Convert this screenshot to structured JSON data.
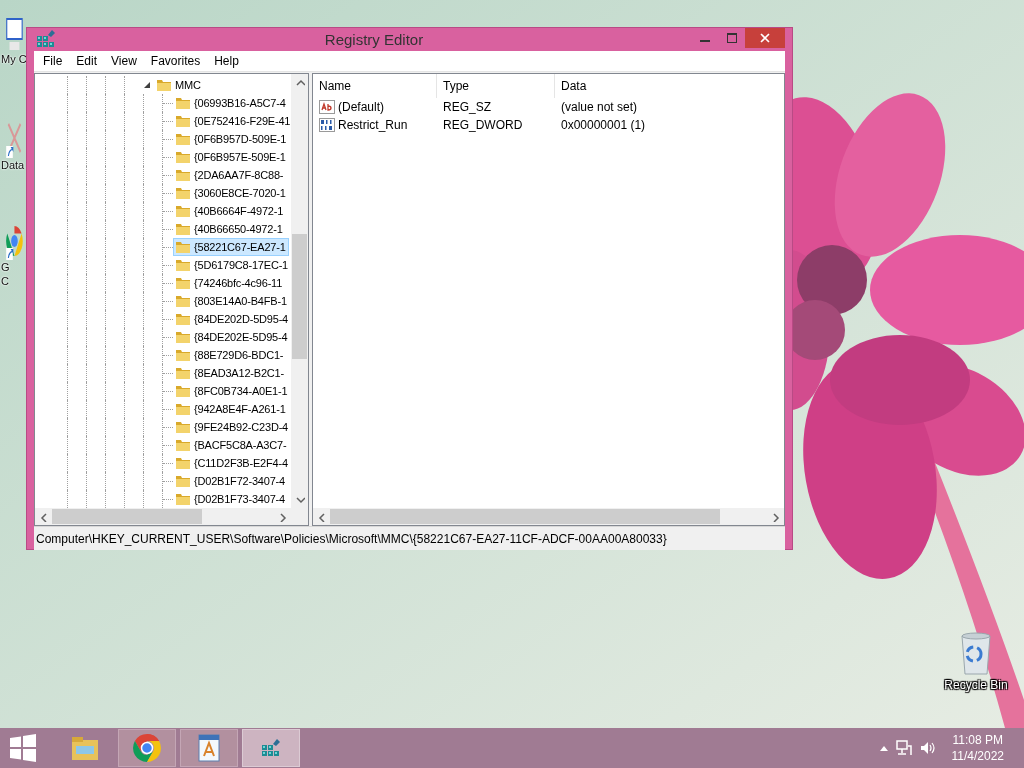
{
  "desktop_icons": [
    {
      "kind": "computer",
      "lines": [
        "My C"
      ]
    },
    {
      "kind": "shortcut",
      "lines": [
        "Data"
      ]
    },
    {
      "kind": "browser",
      "lines": [
        "G",
        "C"
      ]
    }
  ],
  "window": {
    "title": "Registry Editor",
    "menu": [
      "File",
      "Edit",
      "View",
      "Favorites",
      "Help"
    ],
    "tree": [
      {
        "label": "MMC",
        "expanded": true,
        "selected": false,
        "children": [
          {
            "label": "{06993B16-A5C7-4",
            "selected": false
          },
          {
            "label": "{0E752416-F29E-41",
            "selected": false
          },
          {
            "label": "{0F6B957D-509E-1",
            "selected": false
          },
          {
            "label": "{0F6B957E-509E-1",
            "selected": false
          },
          {
            "label": "{2DA6AA7F-8C88-",
            "selected": false
          },
          {
            "label": "{3060E8CE-7020-1",
            "selected": false
          },
          {
            "label": "{40B6664F-4972-1",
            "selected": false
          },
          {
            "label": "{40B66650-4972-1",
            "selected": false
          },
          {
            "label": "{58221C67-EA27-1",
            "selected": true
          },
          {
            "label": "{5D6179C8-17EC-1",
            "selected": false
          },
          {
            "label": "{74246bfc-4c96-11",
            "selected": false
          },
          {
            "label": "{803E14A0-B4FB-1",
            "selected": false
          },
          {
            "label": "{84DE202D-5D95-4",
            "selected": false
          },
          {
            "label": "{84DE202E-5D95-4",
            "selected": false
          },
          {
            "label": "{88E729D6-BDC1-",
            "selected": false
          },
          {
            "label": "{8EAD3A12-B2C1-",
            "selected": false
          },
          {
            "label": "{8FC0B734-A0E1-1",
            "selected": false
          },
          {
            "label": "{942A8E4F-A261-1",
            "selected": false
          },
          {
            "label": "{9FE24B92-C23D-4",
            "selected": false
          },
          {
            "label": "{BACF5C8A-A3C7-",
            "selected": false
          },
          {
            "label": "{C11D2F3B-E2F4-4",
            "selected": false
          },
          {
            "label": "{D02B1F72-3407-4",
            "selected": false
          },
          {
            "label": "{D02B1F73-3407-4",
            "selected": false
          }
        ]
      }
    ],
    "values": {
      "columns": [
        "Name",
        "Type",
        "Data"
      ],
      "rows": [
        {
          "kind": "string",
          "name": "(Default)",
          "type": "REG_SZ",
          "data": "(value not set)"
        },
        {
          "kind": "binary",
          "name": "Restrict_Run",
          "type": "REG_DWORD",
          "data": "0x00000001 (1)"
        }
      ]
    },
    "status_bar": "Computer\\HKEY_CURRENT_USER\\Software\\Policies\\Microsoft\\MMC\\{58221C67-EA27-11CF-ADCF-00AA00A80033}"
  },
  "recycle_bin": {
    "label": "Recycle Bin"
  },
  "taskbar": {
    "apps": [
      {
        "kind": "explorer",
        "running": false,
        "active": false
      },
      {
        "kind": "chrome",
        "running": true,
        "active": false
      },
      {
        "kind": "wordpad",
        "running": true,
        "active": false
      },
      {
        "kind": "regedit",
        "running": true,
        "active": true
      }
    ],
    "time": "11:08 PM",
    "date": "11/4/2022"
  }
}
